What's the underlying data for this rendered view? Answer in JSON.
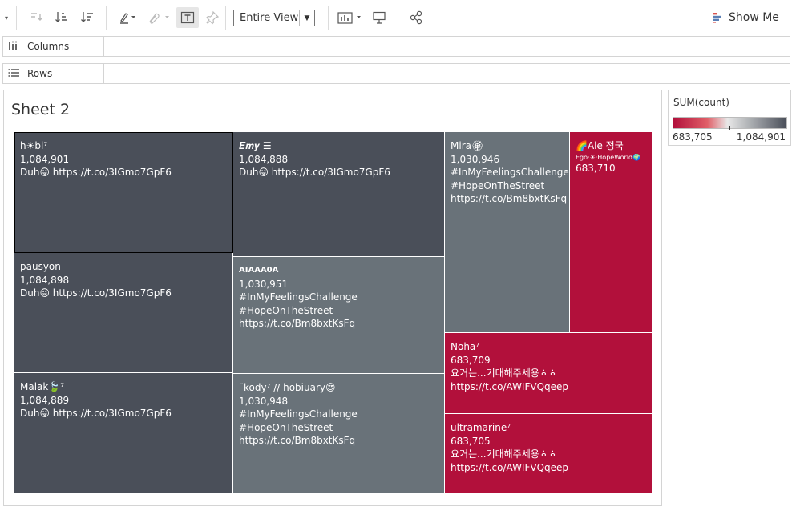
{
  "toolbar": {
    "view_select": "Entire View",
    "show_me_label": "Show Me",
    "icons": [
      "dropdown-arrow",
      "swap-rows-columns",
      "sort-ascending",
      "sort-descending",
      "highlight",
      "clip",
      "text-label",
      "pin",
      "show-hide-cards",
      "presentation",
      "share"
    ]
  },
  "shelves": {
    "columns_label": "Columns",
    "rows_label": "Rows"
  },
  "sheet": {
    "title": "Sheet 2"
  },
  "legend": {
    "title": "SUM(count)",
    "min_label": "683,705",
    "max_label": "1,084,901",
    "colors": {
      "low": "#b2103b",
      "mid": "#e8e8e8",
      "high": "#4a4f59"
    }
  },
  "treemap": {
    "cells": [
      {
        "name": "h☀bi⁷",
        "count": "1,084,901",
        "lines": [
          "Duh😜 https://t.co/3IGmo7GpF6"
        ]
      },
      {
        "name": "𝑬𝒎𝒚 ☰",
        "count": "1,084,888",
        "lines": [
          "Duh😜 https://t.co/3IGmo7GpF6"
        ]
      },
      {
        "name": "Mira🏵",
        "count": "1,030,946",
        "lines": [
          "#InMyFeelingsChallenge",
          "#HopeOnTheStreet",
          "https://t.co/Bm8bxtKsFq"
        ]
      },
      {
        "name": "🌈Ale 정국",
        "sub": "Ego·☀·HopeWorld🌍",
        "count": "683,710",
        "lines": []
      },
      {
        "name": "pausyon",
        "count": "1,084,898",
        "lines": [
          "Duh😜 https://t.co/3IGmo7GpF6"
        ]
      },
      {
        "name": "AIAAA0A",
        "count": "1,030,951",
        "lines": [
          "#InMyFeelingsChallenge",
          "#HopeOnTheStreet",
          "https://t.co/Bm8bxtKsFq"
        ]
      },
      {
        "name": "Noha⁷",
        "count": "683,709",
        "lines": [
          "요거는...기대해주세용ㅎㅎ",
          "https://t.co/AWIFVQqeep"
        ]
      },
      {
        "name": "Malak🍃⁷",
        "count": "1,084,889",
        "lines": [
          "Duh😜 https://t.co/3IGmo7GpF6"
        ]
      },
      {
        "name": "¨kody⁷ // hobiuary😍",
        "count": "1,030,948",
        "lines": [
          "#InMyFeelingsChallenge",
          "#HopeOnTheStreet",
          "https://t.co/Bm8bxtKsFq"
        ]
      },
      {
        "name": "ultramarine⁷",
        "count": "683,705",
        "lines": [
          "요거는...기대해주세용ㅎㅎ",
          "https://t.co/AWIFVQqeep"
        ]
      }
    ]
  }
}
